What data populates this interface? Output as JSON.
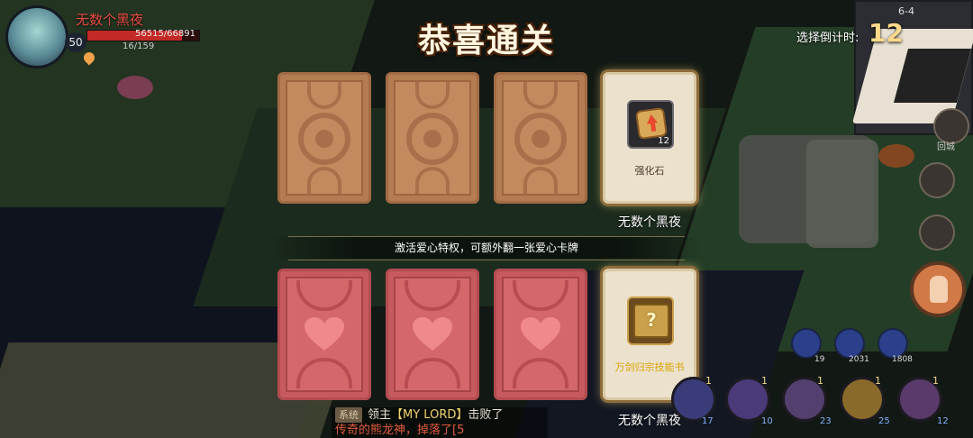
{
  "player": {
    "name": "无数个黑夜",
    "level": "50",
    "hp_text": "56515/66891",
    "hp_fraction": 0.845,
    "mp_text": "16/159"
  },
  "title": "恭喜通关",
  "countdown": {
    "label": "选择倒计时:",
    "value": "12"
  },
  "minimap": {
    "stage": "6-4"
  },
  "normal_cards": {
    "revealed": {
      "item_name": "强化石",
      "count": "12",
      "owner": "无数个黑夜"
    }
  },
  "banner": "激活爱心特权，可额外翻一张爱心卡牌",
  "heart_cards": {
    "revealed": {
      "item_name": "万剑归宗技能书",
      "owner": "无数个黑夜"
    }
  },
  "chat": {
    "tag": "系统",
    "prefix": "领主",
    "lord": "【MY LORD】",
    "suffix": "击败了",
    "line2": "传奇的熊龙神，掉落了[5"
  },
  "side": {
    "return_label": "回城"
  },
  "potions": [
    "19",
    "2031",
    "1808"
  ],
  "skills": [
    {
      "level": "1",
      "count": "17"
    },
    {
      "level": "1",
      "count": "10"
    },
    {
      "level": "1",
      "count": "23"
    },
    {
      "level": "1",
      "count": "25"
    },
    {
      "level": "1",
      "count": "12"
    }
  ],
  "colors": {
    "accent_red": "#e64b43",
    "title_cream": "#fff6e0",
    "countdown_gold": "#ffd98a",
    "skillbook_gold": "#d8a400"
  }
}
